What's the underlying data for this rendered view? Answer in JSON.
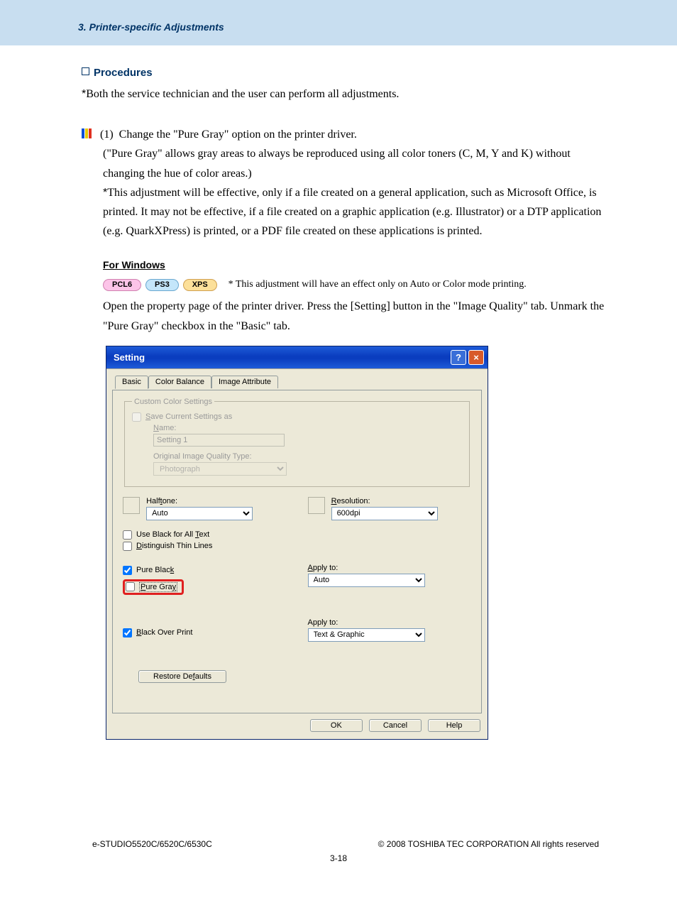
{
  "header": "3. Printer-specific Adjustments",
  "section": {
    "title": "Procedures",
    "intro": "Both the service technician and the user can perform all adjustments."
  },
  "step1": {
    "num": "(1)",
    "text": "Change the \"Pure Gray\" option on the printer driver.",
    "explain": "(\"Pure Gray\" allows gray areas to always be reproduced using all color toners (C, M, Y and K) without changing the hue of color areas.)",
    "note": "This adjustment will be effective, only if a file created on a general application, such as Microsoft Office, is printed.  It may not be effective, if a file created on a graphic application (e.g. Illustrator) or a DTP application (e.g. QuarkXPress) is printed, or a PDF file created on these applications is printed."
  },
  "windows": {
    "heading": "For Windows",
    "badges": {
      "pcl": "PCL6",
      "ps": "PS3",
      "xps": "XPS"
    },
    "badge_note": "* This adjustment will have an effect only on Auto or Color mode printing.",
    "line1": "Open the property page of the printer driver.  Press the [Setting] button in the \"Image Quality\" tab.  Unmark the \"Pure Gray\" checkbox in the \"Basic\" tab."
  },
  "dialog": {
    "title": "Setting",
    "tabs": {
      "basic": "Basic",
      "color": "Color Balance",
      "image": "Image Attribute"
    },
    "group": {
      "legend": "Custom Color Settings",
      "save": "Save Current Settings as",
      "name_lbl": "Name:",
      "name_val": "Setting 1",
      "orig_lbl": "Original Image Quality Type:",
      "orig_val": "Photograph"
    },
    "halftone_lbl": "Halftone:",
    "halftone_val": "Auto",
    "res_lbl": "Resolution:",
    "res_val": "600dpi",
    "chk_blacktext": "Use Black for All Text",
    "chk_thinlines": "Distinguish Thin Lines",
    "chk_pureblack": "Pure Black",
    "chk_puregray": "Pure Gray",
    "chk_blackover": "Black Over Print",
    "apply_lbl": "Apply to:",
    "apply1_val": "Auto",
    "apply2_val": "Text & Graphic",
    "restore": "Restore Defaults",
    "ok": "OK",
    "cancel": "Cancel",
    "help": "Help"
  },
  "footer": {
    "left": "e-STUDIO5520C/6520C/6530C",
    "right": "© 2008 TOSHIBA TEC CORPORATION All rights reserved",
    "page": "3-18"
  }
}
